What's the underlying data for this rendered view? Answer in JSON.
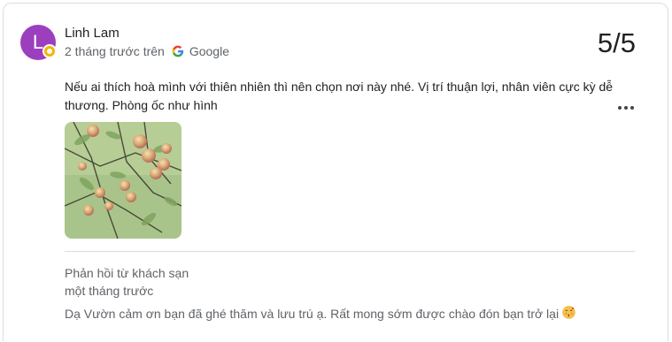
{
  "review": {
    "avatar_letter": "L",
    "avatar_color": "#9c3fbf",
    "reviewer_name": "Linh Lam",
    "time_ago": "2 tháng trước",
    "on_text": "trên",
    "source": "Google",
    "source_icon": "google-g-icon",
    "score": "5/5",
    "text": "Nếu ai thích hoà mình với thiên nhiên thì nên chọn nơi này nhé. Vị trí thuận lợi, nhân viên cực kỳ dễ thương. Phòng ốc như hình",
    "photo_subject": "fruit-tree-photo"
  },
  "owner_reply": {
    "title": "Phản hồi từ khách sạn",
    "time_ago": "một tháng trước",
    "text": "Dạ Vườn cảm ơn bạn đã ghé thăm và lưu trú ạ. Rất mong sớm được chào đón bạn trở lại",
    "emoji_icon": "kissing-face-icon"
  }
}
